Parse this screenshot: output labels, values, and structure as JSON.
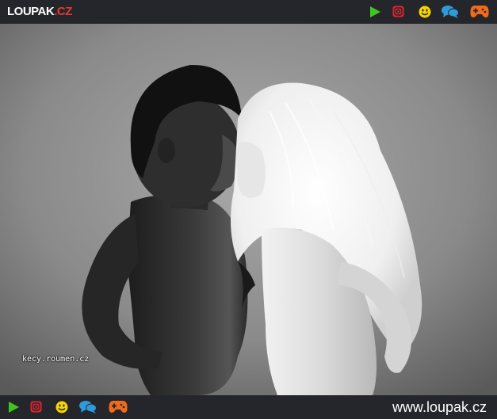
{
  "header": {
    "logo_part1": "LOUPAK",
    "logo_part2": ".CZ",
    "icons": [
      "play-icon",
      "instagram-icon",
      "smiley-icon",
      "chat-icon",
      "gamepad-icon"
    ]
  },
  "photo": {
    "watermark": "kecy.roumen.cz"
  },
  "footer": {
    "icons": [
      "play-icon",
      "instagram-icon",
      "smiley-icon",
      "chat-icon",
      "gamepad-icon"
    ],
    "site_url": "www.loupak.cz"
  },
  "colors": {
    "bar_bg": "#25262b",
    "play": "#3ec61e",
    "instagram": "#e0242f",
    "smiley": "#f5d400",
    "chat": "#2f9ad9",
    "gamepad": "#f06a1c"
  }
}
